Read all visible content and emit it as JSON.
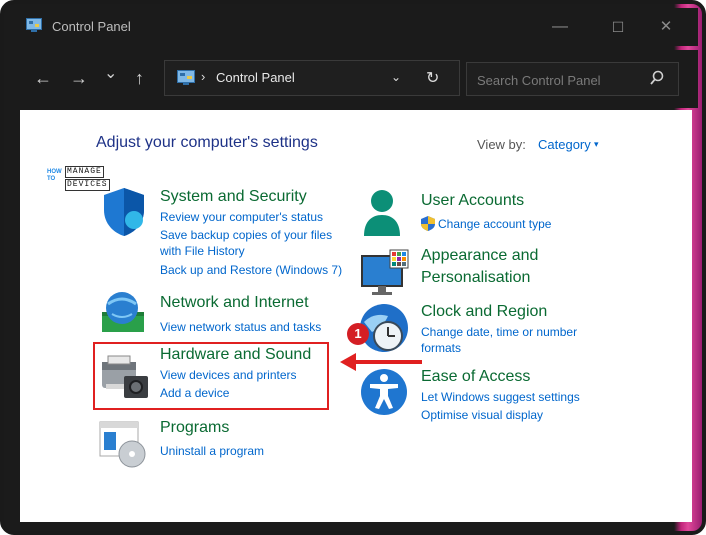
{
  "window": {
    "title": "Control Panel",
    "controls": {
      "minimize": "—",
      "maximize": "☐",
      "close": "✕"
    }
  },
  "nav": {
    "back": "←",
    "forward": "→",
    "recent": "⌄",
    "up": "↑"
  },
  "address": {
    "chevron": "›",
    "path": "Control Panel",
    "dropdown": "⌄",
    "refresh": "↻"
  },
  "search": {
    "placeholder": "Search Control Panel"
  },
  "main": {
    "heading": "Adjust your computer's settings",
    "view_by_label": "View by:",
    "view_by_value": "Category",
    "view_by_arrow": "▾"
  },
  "watermark": {
    "how_to": "HOW TO",
    "manage": "MANAGE",
    "devices": "DEVICES"
  },
  "categories_left": [
    {
      "title": "System and Security",
      "links": [
        "Review your computer's status",
        "Save backup copies of your files",
        "with File History",
        "Back up and Restore (Windows 7)"
      ]
    },
    {
      "title": "Network and Internet",
      "links": [
        "View network status and tasks"
      ]
    },
    {
      "title": "Hardware and Sound",
      "links": [
        "View devices and printers",
        "Add a device"
      ]
    },
    {
      "title": "Programs",
      "links": [
        "Uninstall a program"
      ]
    }
  ],
  "categories_right": [
    {
      "title": "User Accounts",
      "links": [
        "Change account type"
      ]
    },
    {
      "title_line1": "Appearance and",
      "title_line2": "Personalisation"
    },
    {
      "title": "Clock and Region",
      "links": [
        "Change date, time or number",
        "formats"
      ]
    },
    {
      "title": "Ease of Access",
      "links": [
        "Let Windows suggest settings",
        "Optimise visual display"
      ]
    }
  ],
  "annotation": {
    "badge": "1",
    "color": "#e02020"
  },
  "colors": {
    "category_title": "#0a6a32",
    "link": "#0066cc",
    "heading": "#1e3287",
    "titlebar": "#1b1b1b"
  },
  "icons": [
    "control-panel-icon",
    "shield-icon",
    "user-icon",
    "monitor-palette-icon",
    "network-globe-icon",
    "clock-globe-icon",
    "printer-camera-icon",
    "accessibility-icon",
    "programs-disc-icon",
    "search-icon",
    "uac-shield-icon"
  ]
}
